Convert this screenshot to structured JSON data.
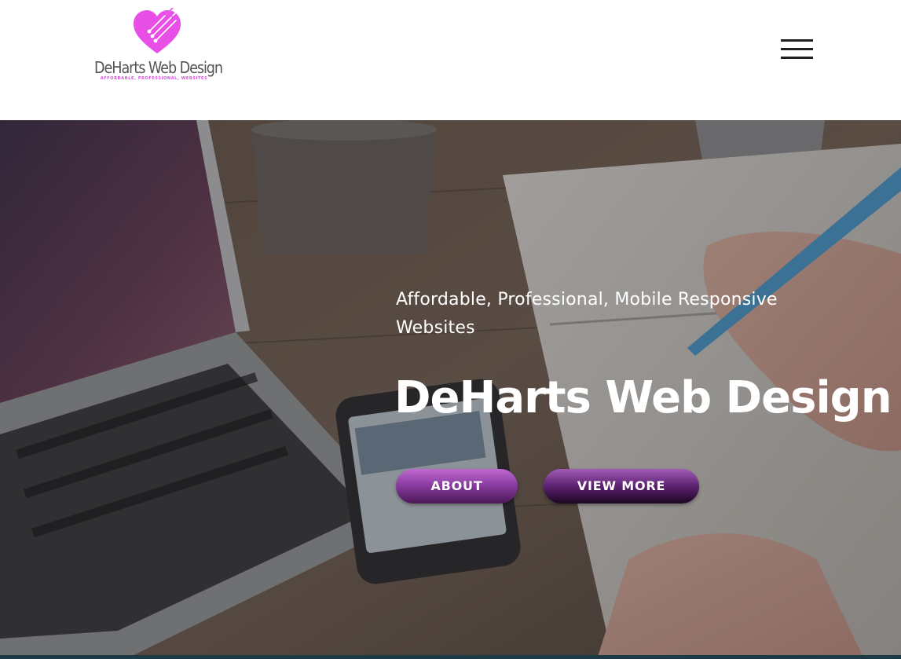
{
  "header": {
    "logo": {
      "name": "DeHarts Web Design",
      "tagline": "AFFORDABLE, PROFESSIONAL, WEBSITES",
      "icon": "heart-circuit-icon",
      "color": "#e84fe6"
    },
    "menu_icon": "hamburger-menu-icon"
  },
  "hero": {
    "background": "laptop-phone-notebook-photo",
    "subtitle": "Affordable, Professional, Mobile Responsive Websites",
    "title": "DeHarts Web Design",
    "buttons": {
      "about_label": "ABOUT",
      "view_more_label": "VIEW MORE"
    },
    "accent_color": "#8b3ea2"
  }
}
